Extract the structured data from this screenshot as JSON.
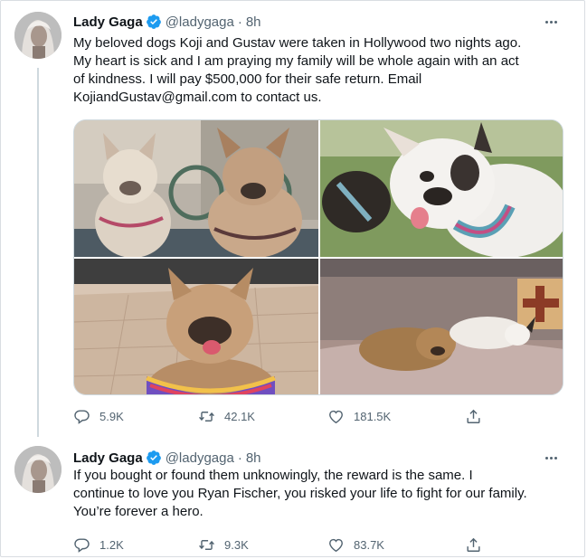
{
  "colors": {
    "verified": "#1d9bf0",
    "text": "#0f1419",
    "muted": "#536471",
    "thread_line": "#cfd9de"
  },
  "tweets": [
    {
      "author": {
        "name": "Lady Gaga",
        "handle": "@ladygaga",
        "verified": true
      },
      "separator": "·",
      "time": "8h",
      "text_lines": [
        "My beloved dogs Koji and Gustav were taken in Hollywood two nights ago.",
        "My heart is sick and I am praying my family will be whole again with an act",
        "of kindness. I will pay $500,000 for their safe return. Email",
        "KojiandGustav@gmail.com to contact us."
      ],
      "media": [
        "two-french-bulldogs-photo",
        "white-french-bulldog-photo",
        "fawn-french-bulldog-photo",
        "sleeping-dogs-photo"
      ],
      "stats": {
        "replies": "5.9K",
        "retweets": "42.1K",
        "likes": "181.5K"
      }
    },
    {
      "author": {
        "name": "Lady Gaga",
        "handle": "@ladygaga",
        "verified": true
      },
      "separator": "·",
      "time": "8h",
      "text_lines": [
        "If you bought or found them unknowingly, the reward is the same. I",
        "continue to love you Ryan Fischer, you risked your life to fight for our family.",
        "You’re forever a hero."
      ],
      "stats": {
        "replies": "1.2K",
        "retweets": "9.3K",
        "likes": "83.7K"
      }
    }
  ],
  "icons": {
    "reply": "reply-icon",
    "retweet": "retweet-icon",
    "like": "like-icon",
    "share": "share-icon",
    "more": "more-icon",
    "verified": "verified-badge-icon"
  }
}
